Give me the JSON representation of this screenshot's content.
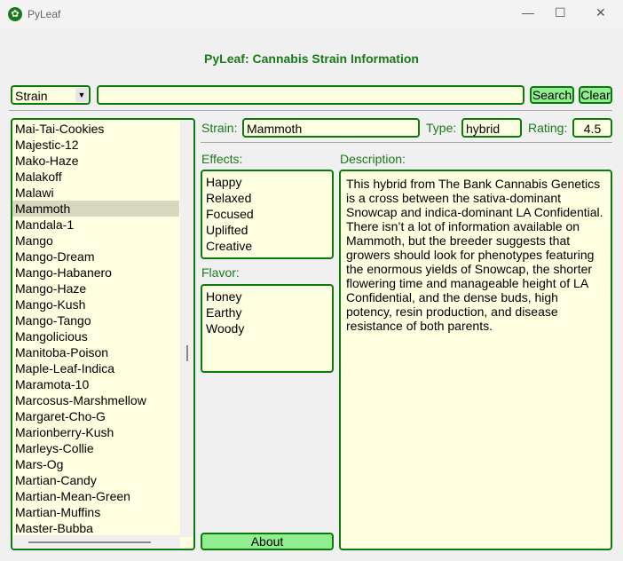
{
  "window": {
    "title": "PyLeaf",
    "minimize": "—",
    "maximize": "☐",
    "close": "✕"
  },
  "header": {
    "title": "PyLeaf: Cannabis Strain Information"
  },
  "search": {
    "mode": "Strain",
    "query": "",
    "search_label": "Search",
    "clear_label": "Clear"
  },
  "strain_list": {
    "items": [
      "Mai-Tai-Cookies",
      "Majestic-12",
      "Mako-Haze",
      "Malakoff",
      "Malawi",
      "Mammoth",
      "Mandala-1",
      "Mango",
      "Mango-Dream",
      "Mango-Habanero",
      "Mango-Haze",
      "Mango-Kush",
      "Mango-Tango",
      "Mangolicious",
      "Manitoba-Poison",
      "Maple-Leaf-Indica",
      "Maramota-10",
      "Marcosus-Marshmellow",
      "Margaret-Cho-G",
      "Marionberry-Kush",
      "Marleys-Collie",
      "Mars-Og",
      "Martian-Candy",
      "Martian-Mean-Green",
      "Martian-Muffins",
      "Master-Bubba"
    ],
    "selected": "Mammoth"
  },
  "details": {
    "strain_label": "Strain:",
    "strain": "Mammoth",
    "type_label": "Type:",
    "type": "hybrid",
    "rating_label": "Rating:",
    "rating": "4.5",
    "effects_label": "Effects:",
    "effects": [
      "Happy",
      "Relaxed",
      "Focused",
      "Uplifted",
      "Creative"
    ],
    "flavor_label": "Flavor:",
    "flavors": [
      "Honey",
      "Earthy",
      "Woody"
    ],
    "description_label": "Description:",
    "description": "This hybrid from The Bank Cannabis Genetics is a cross between the sativa-dominant Snowcap and indica-dominant LA Confidential. There isn’t a lot of  information available on Mammoth, but the breeder suggests that growers should look for phenotypes featuring the enormous yields of Snowcap, the shorter flowering time and manageable height of LA Confidential, and the dense buds, high potency, resin production, and disease resistance of both parents."
  },
  "about_label": "About"
}
